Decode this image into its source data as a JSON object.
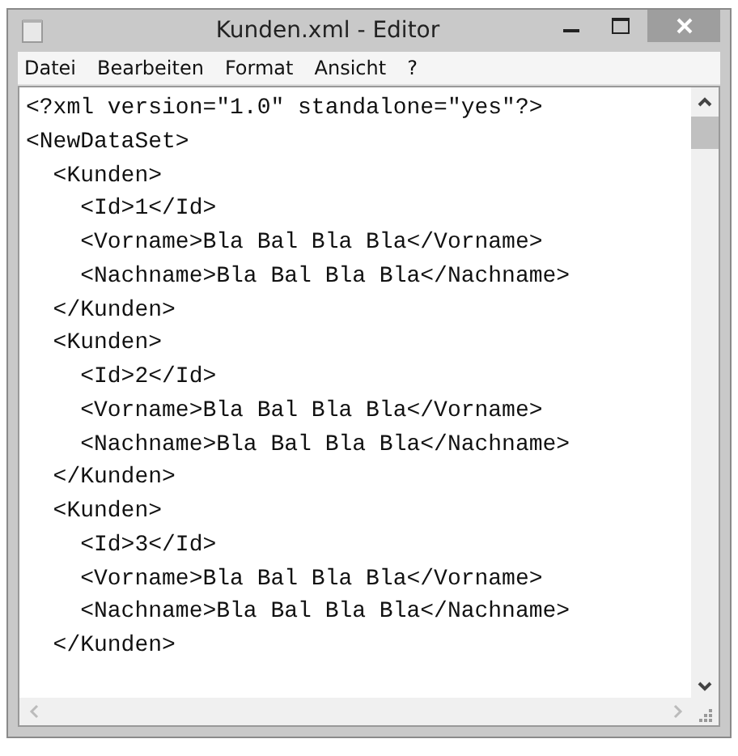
{
  "window": {
    "title": "Kunden.xml - Editor"
  },
  "menu": [
    "Datei",
    "Bearbeiten",
    "Format",
    "Ansicht",
    "?"
  ],
  "editor": {
    "lines": [
      "<?xml version=\"1.0\" standalone=\"yes\"?>",
      "<NewDataSet>",
      "  <Kunden>",
      "    <Id>1</Id>",
      "    <Vorname>Bla Bal Bla Bla</Vorname>",
      "    <Nachname>Bla Bal Bla Bla</Nachname>",
      "  </Kunden>",
      "  <Kunden>",
      "    <Id>2</Id>",
      "    <Vorname>Bla Bal Bla Bla</Vorname>",
      "    <Nachname>Bla Bal Bla Bla</Nachname>",
      "  </Kunden>",
      "  <Kunden>",
      "    <Id>3</Id>",
      "    <Vorname>Bla Bal Bla Bla</Vorname>",
      "    <Nachname>Bla Bal Bla Bla</Nachname>",
      "  </Kunden>"
    ]
  }
}
